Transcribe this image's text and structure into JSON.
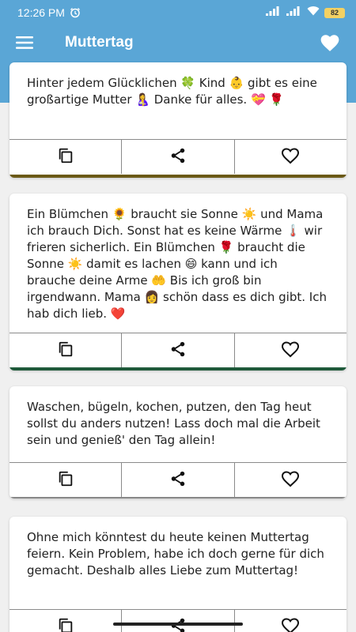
{
  "status_bar": {
    "time": "12:26 PM",
    "battery": "82"
  },
  "app_bar": {
    "title": "Muttertag"
  },
  "cards": [
    {
      "text": "Hinter jedem Glücklichen 🍀 Kind 👶 gibt es eine großartige Mutter 🤱 Danke für alles. 💝 🌹",
      "accent": "#6b5a17"
    },
    {
      "text": "Ein Blümchen 🌻 braucht sie Sonne ☀️ und Mama ich brauch Dich. Sonst hat es keine Wärme 🌡️ wir frieren sicherlich. Ein Blümchen 🌹 braucht die Sonne ☀️ damit es lachen 😄 kann und ich brauche deine Arme 🤲 Bis ich groß bin irgendwann. Mama 👩 schön dass es dich gibt. Ich hab dich lieb. ❤️",
      "accent": "#1f5a3a"
    },
    {
      "text": "Waschen, bügeln, kochen, putzen, den Tag heut sollst du anders nutzen! Lass doch mal die Arbeit sein und genieß' den Tag allein!",
      "accent": "#888888"
    },
    {
      "text": "Ohne mich könntest du heute keinen Muttertag feiern. Kein Problem, habe ich doch gerne für dich gemacht. Deshalb alles Liebe zum Muttertag!",
      "accent": "#888888"
    }
  ],
  "icons": {
    "copy": "copy-icon",
    "share": "share-icon",
    "favorite": "heart-outline-icon"
  },
  "colors": {
    "app_bar": "#5aa6d6"
  }
}
